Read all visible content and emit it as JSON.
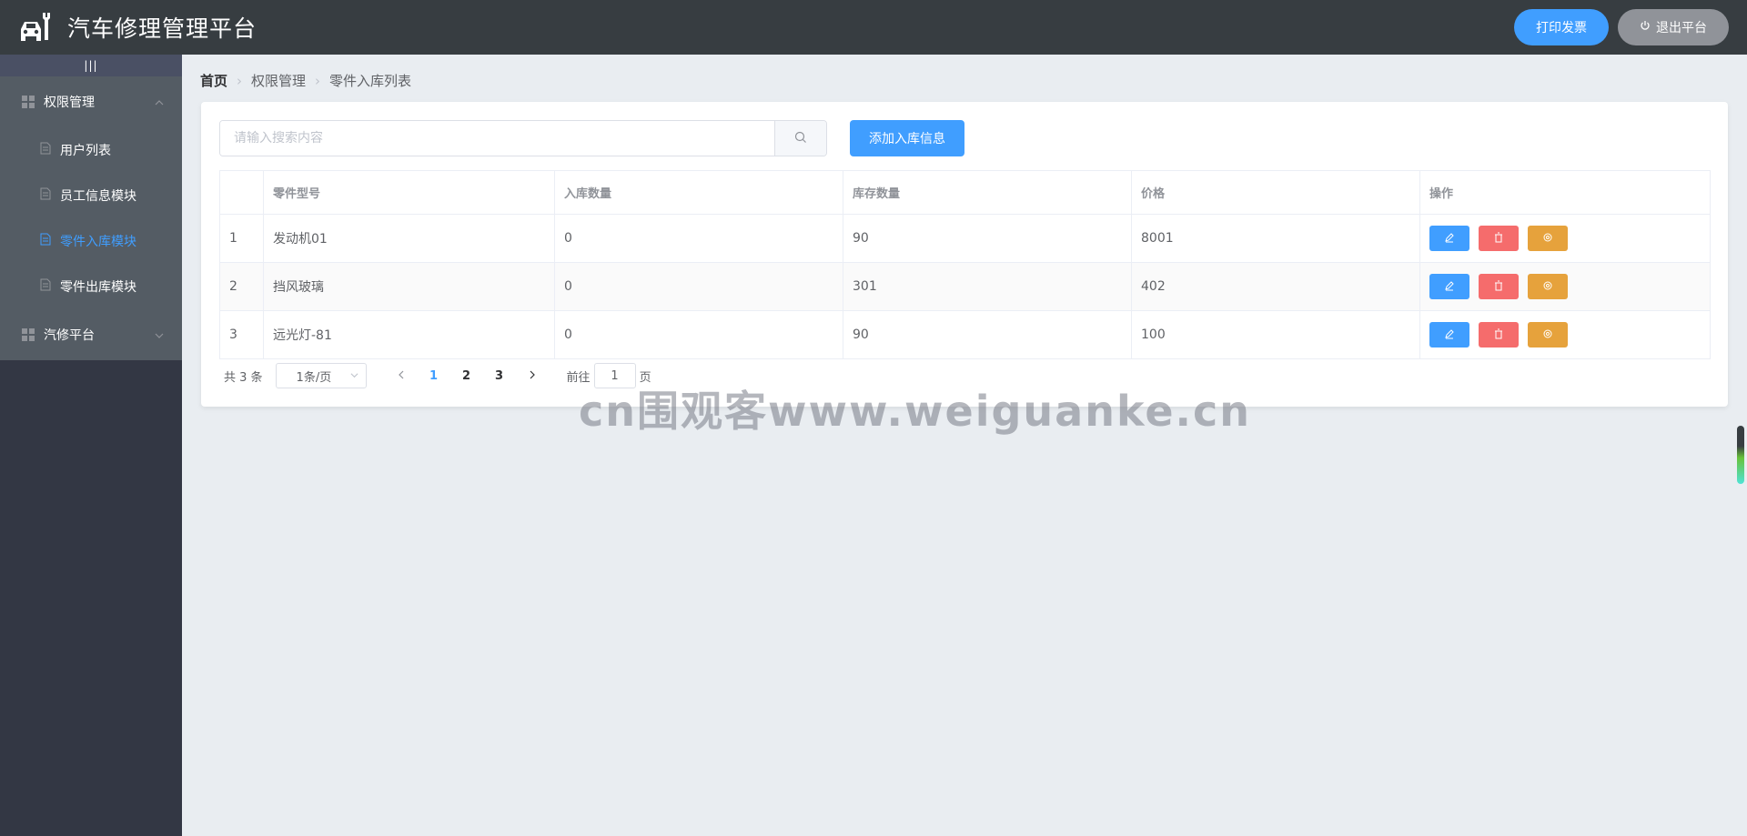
{
  "header": {
    "title": "汽车修理管理平台",
    "print_label": "打印发票",
    "logout_label": "退出平台",
    "logo_icon": "car-wrench-icon"
  },
  "sidebar": {
    "toggle_label": "|||",
    "groups": [
      {
        "label": "权限管理",
        "expanded": true,
        "items": [
          {
            "label": "用户列表",
            "active": false
          },
          {
            "label": "员工信息模块",
            "active": false
          },
          {
            "label": "零件入库模块",
            "active": true
          },
          {
            "label": "零件出库模块",
            "active": false
          }
        ]
      },
      {
        "label": "汽修平台",
        "expanded": false,
        "items": []
      }
    ]
  },
  "breadcrumb": [
    "首页",
    "权限管理",
    "零件入库列表"
  ],
  "search": {
    "placeholder": "请输入搜索内容",
    "value": ""
  },
  "add_button_label": "添加入库信息",
  "table": {
    "columns": [
      "",
      "零件型号",
      "入库数量",
      "库存数量",
      "价格",
      "操作"
    ],
    "rows": [
      {
        "index": "1",
        "model": "发动机01",
        "in_qty": "0",
        "stock": "90",
        "price": "8001"
      },
      {
        "index": "2",
        "model": "挡风玻璃",
        "in_qty": "0",
        "stock": "301",
        "price": "402"
      },
      {
        "index": "3",
        "model": "远光灯-81",
        "in_qty": "0",
        "stock": "90",
        "price": "100"
      }
    ]
  },
  "pagination": {
    "total_text": "共 3 条",
    "page_size": "1条/页",
    "pages": [
      "1",
      "2",
      "3"
    ],
    "current_page": "1",
    "goto_label": "前往",
    "goto_value": "1",
    "page_suffix": "页"
  },
  "watermark": "cn围观客www.weiguanke.cn",
  "colors": {
    "header_bg": "#373d41",
    "sidebar_bg": "#333744",
    "menu_bg": "#545c64",
    "primary": "#409eff",
    "danger": "#f56c6c",
    "warning": "#e6a23c",
    "info": "#909399"
  }
}
